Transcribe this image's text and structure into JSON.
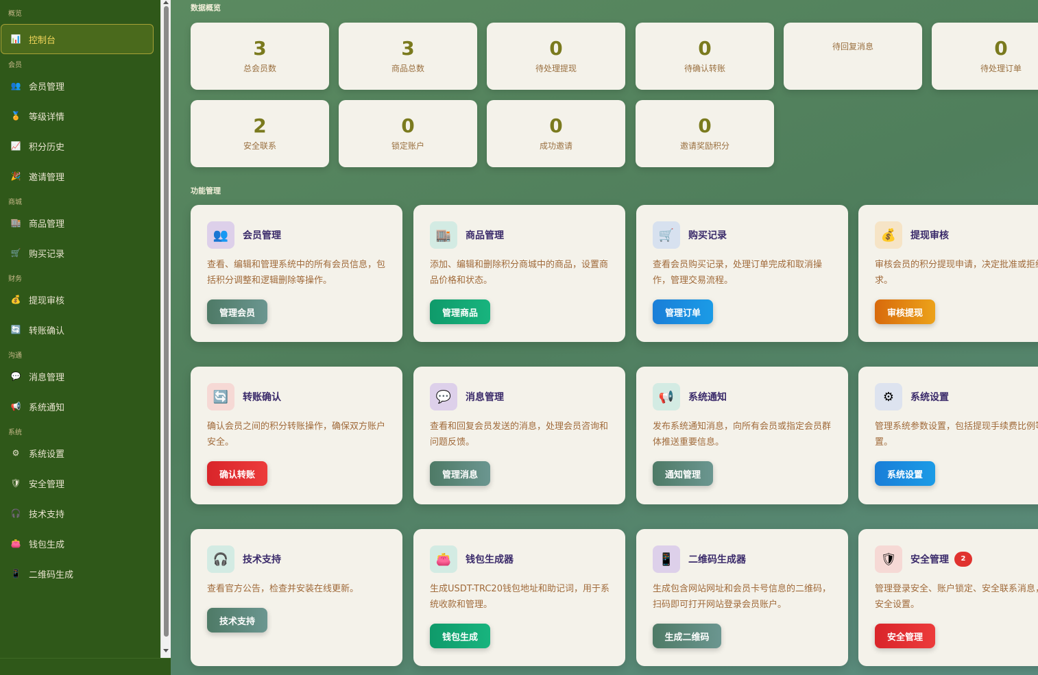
{
  "sidebar": {
    "groups": [
      {
        "label": "概览",
        "items": [
          {
            "label": "控制台",
            "icon": "chart-icon",
            "active": true
          }
        ]
      },
      {
        "label": "会员",
        "items": [
          {
            "label": "会员管理",
            "icon": "users-icon"
          },
          {
            "label": "等级详情",
            "icon": "medal-icon"
          },
          {
            "label": "积分历史",
            "icon": "trend-icon"
          },
          {
            "label": "邀请管理",
            "icon": "party-icon"
          }
        ]
      },
      {
        "label": "商城",
        "items": [
          {
            "label": "商品管理",
            "icon": "shop-icon"
          },
          {
            "label": "购买记录",
            "icon": "cart-icon"
          }
        ]
      },
      {
        "label": "财务",
        "items": [
          {
            "label": "提现审核",
            "icon": "moneybag-icon"
          },
          {
            "label": "转账确认",
            "icon": "refresh-icon"
          }
        ]
      },
      {
        "label": "沟通",
        "items": [
          {
            "label": "消息管理",
            "icon": "chat-icon"
          },
          {
            "label": "系统通知",
            "icon": "megaphone-icon"
          }
        ]
      },
      {
        "label": "系统",
        "items": [
          {
            "label": "系统设置",
            "icon": "gear-icon"
          },
          {
            "label": "安全管理",
            "icon": "shield-icon"
          },
          {
            "label": "技术支持",
            "icon": "headphones-icon"
          },
          {
            "label": "钱包生成",
            "icon": "wallet-icon"
          },
          {
            "label": "二维码生成",
            "icon": "phone-icon"
          }
        ]
      }
    ]
  },
  "overview": {
    "title": "数据概览",
    "stats": [
      {
        "value": "3",
        "label": "总会员数"
      },
      {
        "value": "3",
        "label": "商品总数"
      },
      {
        "value": "0",
        "label": "待处理提现"
      },
      {
        "value": "0",
        "label": "待确认转账"
      },
      {
        "value": "",
        "label": "待回复消息"
      },
      {
        "value": "0",
        "label": "待处理订单"
      },
      {
        "value": "2",
        "label": "安全联系"
      },
      {
        "value": "0",
        "label": "锁定账户"
      },
      {
        "value": "0",
        "label": "成功邀请"
      },
      {
        "value": "0",
        "label": "邀请奖励积分"
      }
    ]
  },
  "features": {
    "title": "功能管理",
    "cards": [
      {
        "title": "会员管理",
        "icon": "users-icon",
        "icon_bg": "#ddd0ea",
        "desc": "查看、编辑和管理系统中的所有会员信息，包括积分调整和逻辑删除等操作。",
        "button": "管理会员",
        "btn_color": "slate"
      },
      {
        "title": "商品管理",
        "icon": "shop-icon",
        "icon_bg": "#d3ebe3",
        "desc": "添加、编辑和删除积分商城中的商品，设置商品价格和状态。",
        "button": "管理商品",
        "btn_color": "green"
      },
      {
        "title": "购买记录",
        "icon": "cart-icon",
        "icon_bg": "#d7e1ef",
        "desc": "查看会员购买记录，处理订单完成和取消操作，管理交易流程。",
        "button": "管理订单",
        "btn_color": "blue"
      },
      {
        "title": "提现审核",
        "icon": "moneybag-icon",
        "icon_bg": "#f6e4c6",
        "desc": "审核会员的积分提现申请，决定批准或拒绝提现请求。",
        "button": "审核提现",
        "btn_color": "orange"
      },
      {
        "title": "转账确认",
        "icon": "refresh-icon",
        "icon_bg": "#f6d9d5",
        "desc": "确认会员之间的积分转账操作，确保双方账户安全。",
        "button": "确认转账",
        "btn_color": "red"
      },
      {
        "title": "消息管理",
        "icon": "chat-icon",
        "icon_bg": "#ddd0ea",
        "desc": "查看和回复会员发送的消息，处理会员咨询和问题反馈。",
        "button": "管理消息",
        "btn_color": "slate"
      },
      {
        "title": "系统通知",
        "icon": "megaphone-icon",
        "icon_bg": "#d3ebe3",
        "desc": "发布系统通知消息，向所有会员或指定会员群体推送重要信息。",
        "button": "通知管理",
        "btn_color": "slate"
      },
      {
        "title": "系统设置",
        "icon": "gear-icon",
        "icon_bg": "#dde3ef",
        "desc": "管理系统参数设置，包括提现手续费比例等重要配置。",
        "button": "系统设置",
        "btn_color": "blue"
      },
      {
        "title": "技术支持",
        "icon": "headphones-icon",
        "icon_bg": "#d3ebe3",
        "desc": "查看官方公告，检查并安装在线更新。",
        "button": "技术支持",
        "btn_color": "slate"
      },
      {
        "title": "钱包生成器",
        "icon": "wallet-icon",
        "icon_bg": "#d3ebe3",
        "desc": "生成USDT-TRC20钱包地址和助记词，用于系统收款和管理。",
        "button": "钱包生成",
        "btn_color": "green"
      },
      {
        "title": "二维码生成器",
        "icon": "phone-icon",
        "icon_bg": "#ddd0ea",
        "desc": "生成包含网站网址和会员卡号信息的二维码，扫码即可打开网站登录会员账户。",
        "button": "生成二维码",
        "btn_color": "slate"
      },
      {
        "title": "安全管理",
        "icon": "shield-icon",
        "icon_bg": "#f6d9d5",
        "desc": "管理登录安全、账户锁定、安全联系消息，以及系统安全设置。",
        "button": "安全管理",
        "btn_color": "red",
        "badge": "2"
      }
    ]
  }
}
